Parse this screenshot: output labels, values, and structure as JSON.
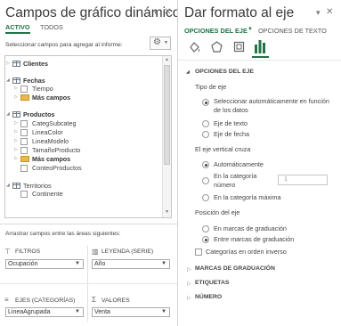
{
  "left_panel": {
    "title": "Campos de gráfico dinámico",
    "tabs": [
      "ACTIVO",
      "TODOS"
    ],
    "choose_label": "Seleccionar campos para agregar al informe:",
    "fields": [
      {
        "label": "Clientes",
        "type": "table",
        "expanded": false,
        "bold": true
      },
      {
        "label": "Fechas",
        "type": "table",
        "expanded": true,
        "bold": true
      },
      {
        "label": "Tiempo",
        "type": "field"
      },
      {
        "label": "Más campos",
        "type": "folder",
        "bold": true
      },
      {
        "label": "Productos",
        "type": "table",
        "expanded": true,
        "bold": true
      },
      {
        "label": "CategSubcateg",
        "type": "field"
      },
      {
        "label": "LineaColor",
        "type": "field"
      },
      {
        "label": "LineaModelo",
        "type": "field"
      },
      {
        "label": "TamañoProducto",
        "type": "field"
      },
      {
        "label": "Más campos",
        "type": "folder",
        "bold": true
      },
      {
        "label": "ConteoProductos",
        "type": "field"
      },
      {
        "label": "Territorios",
        "type": "table",
        "expanded": true,
        "bold": false
      },
      {
        "label": "Continente",
        "type": "field"
      }
    ],
    "drag_label": "Arrastrar campos entre las áreas siguientes:",
    "areas": {
      "filters": {
        "label": "FILTROS",
        "value": "Ocupación"
      },
      "legend": {
        "label": "LEYENDA (SERIE)",
        "value": "Año"
      },
      "axis": {
        "label": "EJES (CATEGORÍAS)",
        "value": "LineaAgrupada"
      },
      "values": {
        "label": "VALORES",
        "value": "Venta"
      }
    }
  },
  "right_panel": {
    "title": "Dar formato al eje",
    "tabs": [
      "OPCIONES DEL EJE",
      "OPCIONES DE TEXTO"
    ],
    "section": "OPCIONES DEL EJE",
    "tipo_label": "Tipo de eje",
    "tipo_options": [
      "Seleccionar automáticamente en función de los datos",
      "Eje de texto",
      "Eje de fecha"
    ],
    "cruza_label": "El eje vertical cruza",
    "cruza_options": [
      "Automáticamente",
      "En la categoría número",
      "En la categoría máxima"
    ],
    "cruza_value": "1",
    "posicion_label": "Posición del eje",
    "posicion_options": [
      "En marcas de graduación",
      "Entre marcas de graduación"
    ],
    "reverse_label": "Categorías en orden inverso",
    "collapsed_sections": [
      "MARCAS DE GRADUACIÓN",
      "ETIQUETAS",
      "NÚMERO"
    ],
    "accent": "#217346"
  }
}
